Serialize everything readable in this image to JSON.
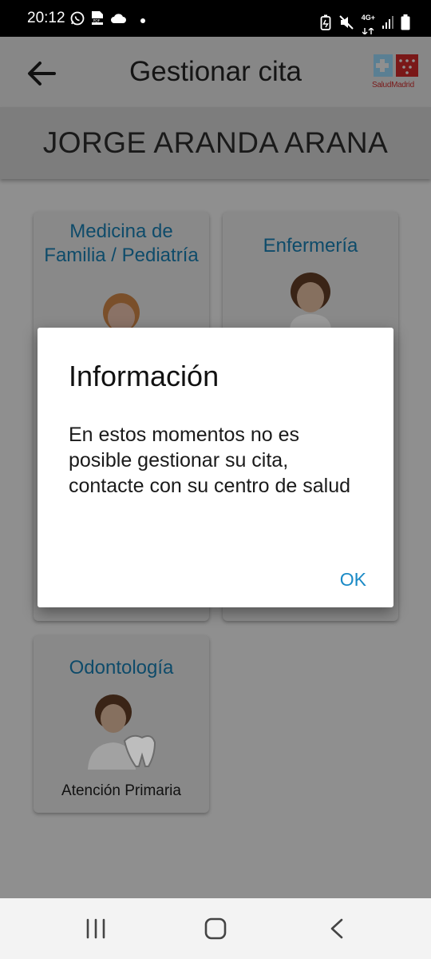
{
  "status_bar": {
    "time": "20:12",
    "left_icons": [
      "whatsapp-icon",
      "pdf-icon",
      "cloud-icon",
      "dot-icon"
    ],
    "right_icons": [
      "battery-saver-icon",
      "mute-icon",
      "network-4g-icon",
      "signal-icon",
      "battery-icon"
    ],
    "network_label_top": "4G+"
  },
  "app_bar": {
    "title": "Gestionar cita",
    "back_icon": "arrow-left-icon",
    "logo_text": "SaludMadrid"
  },
  "patient": {
    "name": "JORGE ARANDA ARANA"
  },
  "cards": [
    {
      "title": "Medicina de Familia / Pediatría",
      "subtitle": ""
    },
    {
      "title": "Enfermería",
      "subtitle": ""
    },
    {
      "title": "Odontología",
      "subtitle": "Atención Primaria"
    }
  ],
  "dialog": {
    "title": "Información",
    "message": "En estos momentos no es posible gestionar su cita, contacte con su centro de salud",
    "ok_label": "OK"
  },
  "colors": {
    "accent": "#1a8ac6",
    "card_title": "#0e4b6a",
    "overlay_background": "#8f8f8f"
  },
  "nav_bar": {
    "icons": [
      "recent-apps-icon",
      "home-icon",
      "back-icon"
    ]
  }
}
